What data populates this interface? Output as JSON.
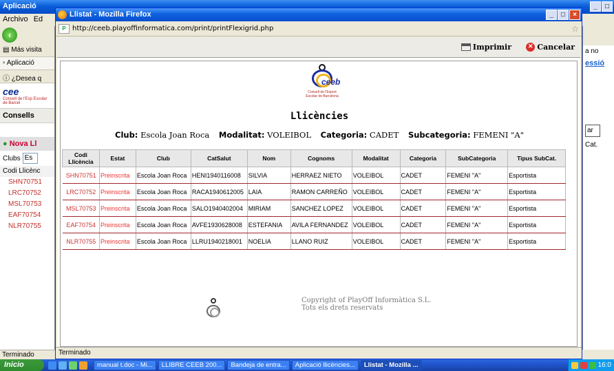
{
  "background_window": {
    "title": "Aplicació",
    "menu": [
      "Archivo",
      "Ed"
    ],
    "nav_tabs": [
      "Más visita",
      "Aplicació"
    ],
    "notice": "¿Desea q",
    "logo_text": "cee",
    "logo_sub": "Consell de l'Esp Escolar de Barcel",
    "section": "Consells",
    "nova_button": "Nova Ll",
    "clubs_label": "Clubs",
    "clubs_value": "Es",
    "list_header": "Codi Llicènc",
    "list_items": [
      "SHN70751",
      "LRC70752",
      "MSL70753",
      "EAF70754",
      "NLR70755"
    ],
    "right_text": "a no",
    "right_session": "essió",
    "right_button": "ar",
    "right_cat": "Cat.",
    "status": "Terminado"
  },
  "popup": {
    "title": "Llistat - Mozilla Firefox",
    "url": "http://ceeb.playoffinformatica.com/print/printFlexigrid.php",
    "print_label": "Imprimir",
    "cancel_label": "Cancelar",
    "logo": {
      "name": "ceeb",
      "subtitle_line1": "Consell de l'Esport",
      "subtitle_line2": "Escolar de Barcelona"
    },
    "heading": "Llicències",
    "filters": {
      "club_label": "Club:",
      "club_value": "Escola Joan Roca",
      "modalitat_label": "Modalitat:",
      "modalitat_value": "VOLEIBOL",
      "categoria_label": "Categoria:",
      "categoria_value": "CADET",
      "subcategoria_label": "Subcategoria:",
      "subcategoria_value": "FEMENI \"A\""
    },
    "table": {
      "headers": [
        "Codi Llicència",
        "Estat",
        "Club",
        "CatSalut",
        "Nom",
        "Cognoms",
        "Modalitat",
        "Categoria",
        "SubCategoria",
        "Tipus SubCat."
      ],
      "rows": [
        [
          "SHN70751",
          "Preinscrita",
          "Escola Joan Roca",
          "HENI1940116008",
          "SILVIA",
          "HERRAEZ NIETO",
          "VOLEIBOL",
          "CADET",
          "FEMENI \"A\"",
          "Esportista"
        ],
        [
          "LRC70752",
          "Preinscrita",
          "Escola Joan Roca",
          "RACA1940612005",
          "LAIA",
          "RAMON CARREÑO",
          "VOLEIBOL",
          "CADET",
          "FEMENI \"A\"",
          "Esportista"
        ],
        [
          "MSL70753",
          "Preinscrita",
          "Escola Joan Roca",
          "SALO1940402004",
          "MIRIAM",
          "SANCHEZ LOPEZ",
          "VOLEIBOL",
          "CADET",
          "FEMENI \"A\"",
          "Esportista"
        ],
        [
          "EAF70754",
          "Preinscrita",
          "Escola Joan Roca",
          "AVFE1930628008",
          "ESTEFANIA",
          "AVILA FERNANDEZ",
          "VOLEIBOL",
          "CADET",
          "FEMENI \"A\"",
          "Esportista"
        ],
        [
          "NLR70755",
          "Preinscrita",
          "Escola Joan Roca",
          "LLRU1940218001",
          "NOELIA",
          "LLANO RUIZ",
          "VOLEIBOL",
          "CADET",
          "FEMENI \"A\"",
          "Esportista"
        ]
      ]
    },
    "copyright_line1": "Copyright of PlayOff Informàtica S.L.",
    "copyright_line2": "Tots els drets reservats",
    "status": "Terminado"
  },
  "taskbar": {
    "start": "Inicio",
    "tasks": [
      {
        "label": "manual t.doc - Mi..."
      },
      {
        "label": "LLIBRE CEEB 200..."
      },
      {
        "label": "Bandeja de entra..."
      },
      {
        "label": "Aplicació llicències..."
      },
      {
        "label": "Llistat - Mozilla ..."
      }
    ],
    "clock": "16:0"
  },
  "colors": {
    "link_red": "#c33333",
    "estat_red": "#ee3333",
    "row_border": "#a0242a",
    "title_blue": "#0a5fd8"
  }
}
